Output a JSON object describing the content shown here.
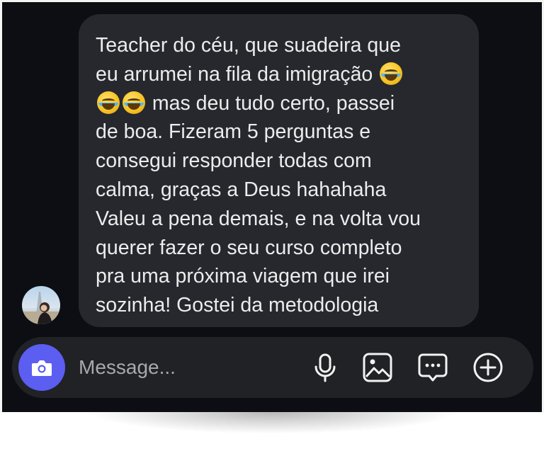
{
  "conversation": {
    "message": {
      "lines": [
        "Teacher do céu, que suadeira que",
        "eu arrumei na fila da imigração",
        "mas deu tudo certo, passei",
        "de boa. Fizeram 5 perguntas e",
        "consegui responder todas com",
        "calma, graças a Deus hahahaha",
        "Valeu a pena demais, e na volta vou",
        "querer fazer o seu curso completo",
        "pra uma próxima viagem que irei",
        "sozinha! Gostei da metodologia"
      ],
      "emoji_icon": "face-with-tears-of-joy-icon"
    }
  },
  "composer": {
    "placeholder": "Message...",
    "icons": [
      "camera-icon",
      "microphone-icon",
      "image-icon",
      "sticker-icon",
      "plus-icon"
    ]
  },
  "colors": {
    "background": "#0c0e13",
    "bubble": "#26282e",
    "camera_button": "#5b5ef1",
    "text": "#ececec"
  }
}
